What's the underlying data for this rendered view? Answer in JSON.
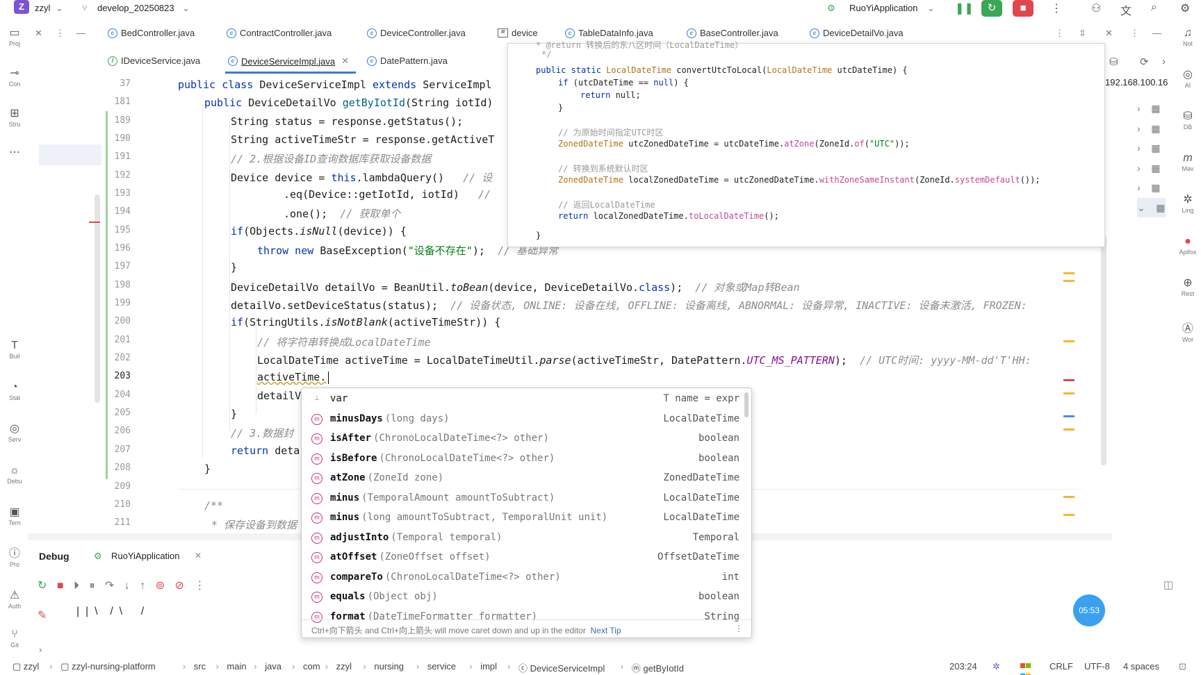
{
  "titlebar": {
    "project_badge": "Z",
    "project_name": "zzyl",
    "branch": "develop_20250823",
    "run_config": "RuoYiApplication"
  },
  "tabs_row1": [
    "BedController.java",
    "ContractController.java",
    "DeviceController.java",
    "device",
    "TableDataInfo.java",
    "BaseController.java",
    "DeviceDetailVo.java"
  ],
  "tabs_row2": [
    "IDeviceService.java",
    "DeviceServiceImpl.java",
    "DatePattern.java"
  ],
  "left_strip": [
    "Proj",
    "Con",
    "Stru",
    "",
    "Buil",
    "Stat",
    "Serv",
    "Debu",
    "Tern",
    "Pro",
    "Auth",
    "Git"
  ],
  "right_strip": [
    "Not",
    "AI",
    "DB",
    "Mav",
    "Ling",
    "Apifox",
    "Rest",
    "Wor"
  ],
  "db_host": "192.168.100.16",
  "gutter": [
    "37",
    "181",
    "189",
    "190",
    "191",
    "192",
    "193",
    "194",
    "195",
    "196",
    "197",
    "198",
    "199",
    "200",
    "201",
    "202",
    "203",
    "204",
    "205",
    "206",
    "207",
    "208",
    "209",
    "210",
    "211"
  ],
  "code": [
    "public class DeviceServiceImpl extends ServiceImpl",
    "public DeviceDetailVo getByIotId(String iotId)",
    "String status = response.getStatus();",
    "String activeTimeStr = response.getActiveT",
    "// 2.根据设备ID查询数据库获取设备数据",
    "Device device = this.lambdaQuery()   // 设",
    ".eq(Device::getIotId, iotId)   //",
    ".one();  // 获取单个",
    "if(Objects.isNull(device)) {",
    "throw new BaseException(\"设备不存在\");  // 基础异常",
    "}",
    "DeviceDetailVo detailVo = BeanUtil.toBean(device, DeviceDetailVo.class);  // 对象或Map转Bean",
    "detailVo.setDeviceStatus(status);  // 设备状态, ONLINE: 设备在线, OFFLINE: 设备离线, ABNORMAL: 设备异常, INACTIVE: 设备未激活, FROZEN:",
    "if(StringUtils.isNotBlank(activeTimeStr)) {",
    "// 将字符串转换成LocalDateTime",
    "LocalDateTime activeTime = LocalDateTimeUtil.parse(activeTimeStr, DatePattern.UTC_MS_PATTERN);  // UTC时间: yyyy-MM-dd'T'HH:",
    "activeTime.",
    "detailV",
    "}",
    "// 3.数据封",
    "return deta",
    "}",
    "",
    "/**",
    "* 保存设备到数据"
  ],
  "doc": [
    "* @return 转换后的东八区时间（LocalDateTime）",
    "*/",
    "public static LocalDateTime convertUtcToLocal(LocalDateTime utcDateTime) {",
    "if (utcDateTime == null) {",
    "return null;",
    "}",
    "// 为原始时间指定UTC时区",
    "ZonedDateTime utcZonedDateTime = utcDateTime.atZone(ZoneId.of(\"UTC\"));",
    "// 转换到系统默认时区",
    "ZonedDateTime localZonedDateTime = utcZonedDateTime.withZoneSameInstant(ZoneId.systemDefault());",
    "// 返回LocalDateTime",
    "return localZonedDateTime.toLocalDateTime();",
    "}"
  ],
  "completion": {
    "items": [
      {
        "name": "var",
        "params": "",
        "type": "T name = expr"
      },
      {
        "name": "minusDays",
        "params": "(long days)",
        "type": "LocalDateTime"
      },
      {
        "name": "isAfter",
        "params": "(ChronoLocalDateTime<?> other)",
        "type": "boolean"
      },
      {
        "name": "isBefore",
        "params": "(ChronoLocalDateTime<?> other)",
        "type": "boolean"
      },
      {
        "name": "atZone",
        "params": "(ZoneId zone)",
        "type": "ZonedDateTime"
      },
      {
        "name": "minus",
        "params": "(TemporalAmount amountToSubtract)",
        "type": "LocalDateTime"
      },
      {
        "name": "minus",
        "params": "(long amountToSubtract, TemporalUnit unit)",
        "type": "LocalDateTime"
      },
      {
        "name": "adjustInto",
        "params": "(Temporal temporal)",
        "type": "Temporal"
      },
      {
        "name": "atOffset",
        "params": "(ZoneOffset offset)",
        "type": "OffsetDateTime"
      },
      {
        "name": "compareTo",
        "params": "(ChronoLocalDateTime<?> other)",
        "type": "int"
      },
      {
        "name": "equals",
        "params": "(Object obj)",
        "type": "boolean"
      },
      {
        "name": "format",
        "params": "(DateTimeFormatter formatter)",
        "type": "String"
      }
    ],
    "footer": "Ctrl+向下箭头 and Ctrl+向上箭头 will move caret down and up in the editor",
    "next_tip": "Next Tip"
  },
  "debug": {
    "title": "Debug",
    "session": "RuoYiApplication"
  },
  "timer": "05:53",
  "status": {
    "breadcrumbs": [
      "zzyl",
      "zzyl-nursing-platform",
      "src",
      "main",
      "java",
      "com",
      "zzyl",
      "nursing",
      "service",
      "impl",
      "DeviceServiceImpl",
      "getByIotId"
    ],
    "position": "203:24",
    "line_sep": "CRLF",
    "encoding": "UTF-8",
    "indent": "4 spaces"
  },
  "colors": {
    "accent": "#3a7bd5",
    "keyword": "#0033b3",
    "string": "#067d17",
    "comment": "#8c8c8c",
    "run_green": "#3aa757",
    "stop_red": "#e0474c"
  }
}
